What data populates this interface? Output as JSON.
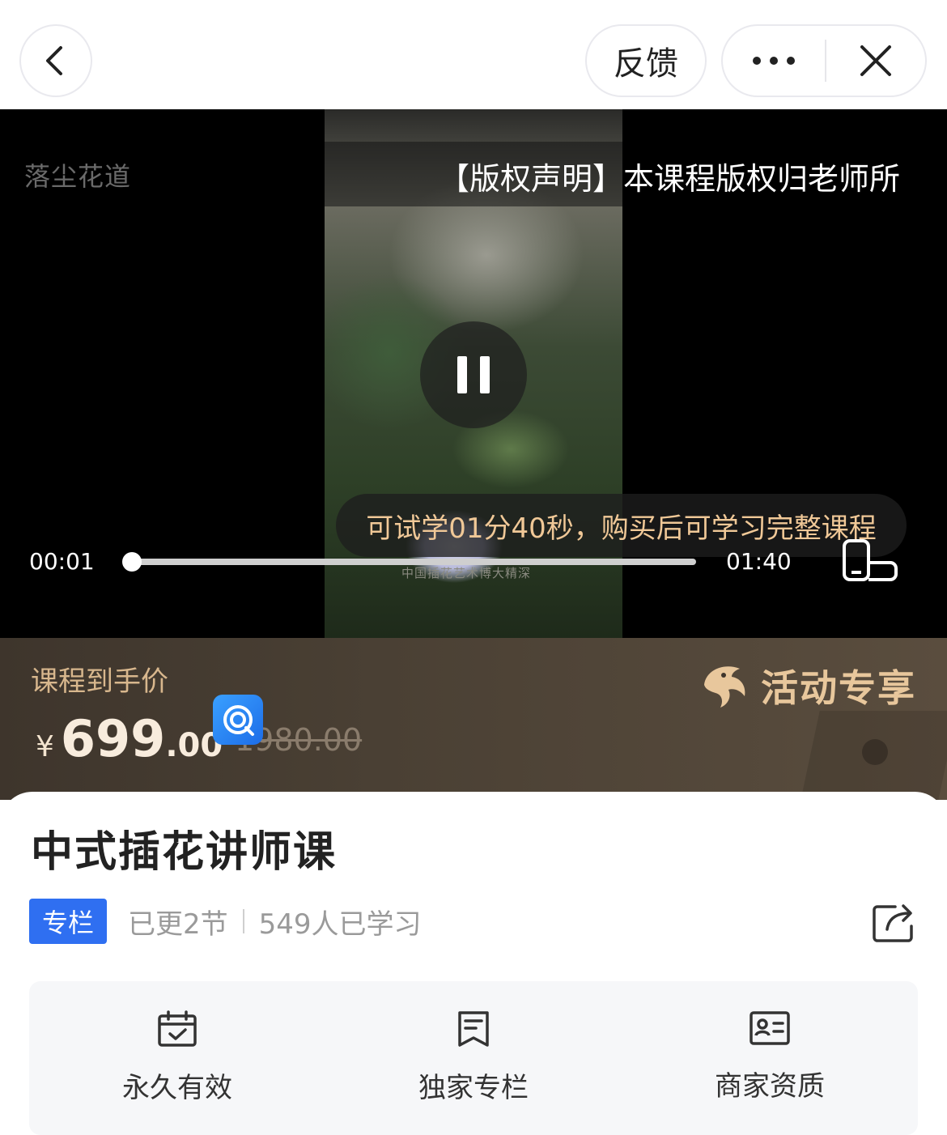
{
  "topbar": {
    "feedback_label": "反馈",
    "more_icon": "more-dots-icon",
    "close_icon": "close-icon",
    "back_icon": "chevron-left-icon"
  },
  "video": {
    "brand_tag": "落尘花道",
    "copyright_notice": "【版权声明】本课程版权归老师所",
    "trial_notice": "可试学01分40秒，购买后可学习完整课程",
    "current_time": "00:01",
    "total_time": "01:40",
    "progress_fraction": 0.0,
    "frame_caption": "中国插花艺术博大精深",
    "state": "playing"
  },
  "promo": {
    "label": "课程到手价",
    "currency": "¥",
    "price_int": "699",
    "price_dec": ".00",
    "original_price": "1980.00",
    "activity_label": "活动专享"
  },
  "course": {
    "title": "中式插花讲师课",
    "badge": "专栏",
    "updated": "已更2节",
    "learners": "549人已学习"
  },
  "features": [
    {
      "icon": "calendar-check-icon",
      "label": "永久有效"
    },
    {
      "icon": "document-icon",
      "label": "独家专栏"
    },
    {
      "icon": "id-card-icon",
      "label": "商家资质"
    }
  ],
  "colors": {
    "accent_blue": "#2f6ff1",
    "promo_gold": "#d8b78d",
    "trial_text": "#f0c897"
  }
}
